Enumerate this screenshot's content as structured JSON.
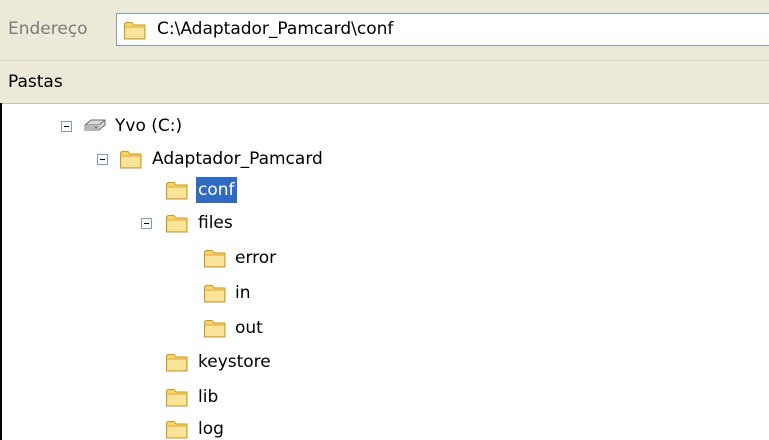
{
  "address_bar": {
    "label": "Endereço",
    "path": "C:\\Adaptador_Pamcard\\conf",
    "icon": "folder-icon"
  },
  "folders_pane": {
    "title": "Pastas"
  },
  "tree": {
    "drive": {
      "label": "Yvo (C:)",
      "icon": "drive-icon",
      "expanded": true
    },
    "adaptador": {
      "label": "Adaptador_Pamcard",
      "icon": "folder-icon",
      "expanded": true
    },
    "conf": {
      "label": "conf",
      "icon": "folder-icon",
      "selected": true
    },
    "files": {
      "label": "files",
      "icon": "folder-icon",
      "expanded": true
    },
    "error": {
      "label": "error",
      "icon": "folder-icon"
    },
    "in": {
      "label": "in",
      "icon": "folder-icon"
    },
    "out": {
      "label": "out",
      "icon": "folder-icon"
    },
    "keystore": {
      "label": "keystore",
      "icon": "folder-icon"
    },
    "lib": {
      "label": "lib",
      "icon": "folder-icon"
    },
    "log": {
      "label": "log",
      "icon": "folder-icon"
    }
  },
  "colors": {
    "selection": "#316ac5",
    "toolbar_bg": "#ece9d8",
    "folder_fill": "#f8d775",
    "folder_edge": "#c89a2c"
  }
}
